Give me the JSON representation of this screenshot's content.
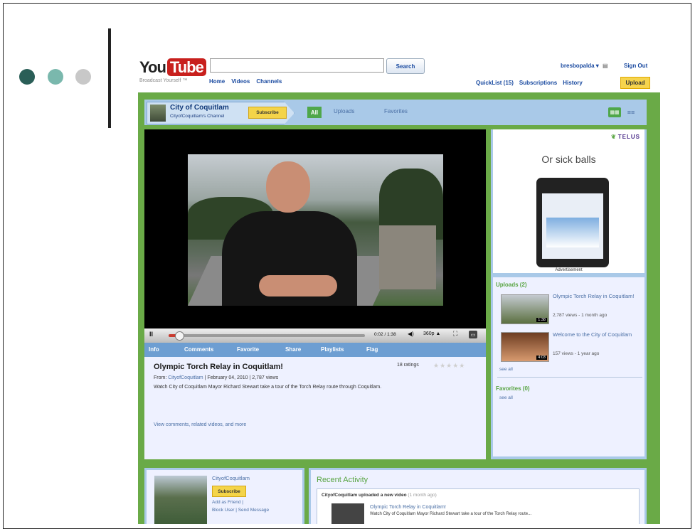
{
  "colors": {
    "dot_1": "#2a5e57",
    "dot_2": "#7ab8ad",
    "dot_3": "#c8c8c8",
    "accent_green": "#6aaa47",
    "link_blue": "#1a4aa0",
    "panel_blue": "#a9c9e8",
    "youtube_red": "#c8201d"
  },
  "header": {
    "logo_you": "You",
    "logo_tube": "Tube",
    "logo_sub": "Broadcast Yourself ™",
    "search_button": "Search",
    "nav": [
      "Home",
      "Videos",
      "Channels"
    ],
    "username": "bresbopalda ▾",
    "mail_icon": "▤",
    "sign_out": "Sign Out",
    "quicklist": "QuickList (15)",
    "subscriptions": "Subscriptions",
    "history": "History",
    "upload": "Upload"
  },
  "channel": {
    "name": "City of Coquitlam",
    "channel_label": "CityofCoquitlam's Channel",
    "subscribe": "Subscribe",
    "tabs": {
      "all": "All",
      "uploads": "Uploads",
      "favorites": "Favorites"
    },
    "grid_view": "▦▦",
    "list_view": "≡≡"
  },
  "player": {
    "pause": "II",
    "progress_fraction": 0.05,
    "time": "0:02 / 1:38",
    "volume": "◀)",
    "quality": "360p ▲",
    "fullscreen": "⛶",
    "popout": "▭"
  },
  "video_tabs": [
    "Info",
    "Comments",
    "Favorite",
    "Share",
    "Playlists",
    "Flag"
  ],
  "video_info": {
    "title": "Olympic Torch Relay in Coquitlam!",
    "ratings": "18 ratings",
    "stars": "★★★★★",
    "from_label": "From:",
    "from_user": "CityofCoquitlam",
    "from_rest": " | February 04, 2010 | 2,787 views",
    "description": "Watch City of Coquitlam Mayor Richard Stewart take a tour of the Torch Relay route through Coquitlam.",
    "more_link": "View comments, related videos, and more"
  },
  "ad": {
    "brand": "TELUS",
    "leaf": "❦",
    "tagline": "Or sick balls",
    "label": "Advertisement"
  },
  "uploads": {
    "heading": "Uploads (2)",
    "items": [
      {
        "title": "Olympic Torch Relay in Coquitlam!",
        "meta": "2,787 views - 1 month ago",
        "duration": "1:38"
      },
      {
        "title": "Welcome to the City of Coquitlam",
        "meta": "157 views - 1 year ago",
        "duration": "4:03"
      }
    ],
    "see_all": "see all"
  },
  "favorites": {
    "heading": "Favorites (0)",
    "see_all": "see all"
  },
  "profile": {
    "name": "CityofCoquitlam",
    "subscribe": "Subscribe",
    "add_friend": "Add as Friend |",
    "block_links": "Block User | Send Message"
  },
  "recent_activity": {
    "title": "Recent Activity",
    "line_user": "CityofCoquitlam uploaded a new video",
    "line_time": " (1 month ago)",
    "video_title": "Olympic Torch Relay in Coquitlam!",
    "video_desc": "Watch City of Coquitlam Mayor Richard Stewart take a tour of the Torch Relay route..."
  }
}
